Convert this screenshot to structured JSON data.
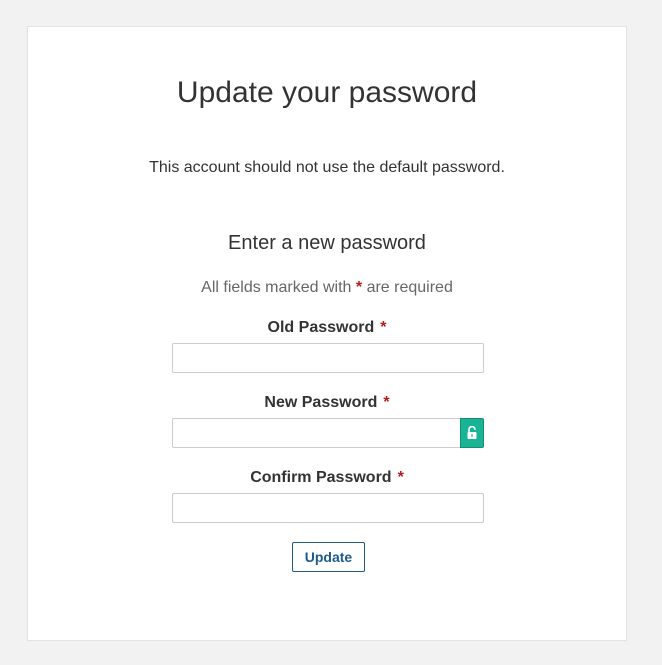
{
  "page": {
    "title": "Update your password",
    "subtitle": "This account should not use the default password."
  },
  "form": {
    "section_title": "Enter a new password",
    "required_note_before": "All fields marked with",
    "required_marker": "*",
    "required_note_after": "are required",
    "fields": [
      {
        "label": "Old Password",
        "value": "",
        "required": true
      },
      {
        "label": "New Password",
        "value": "",
        "required": true,
        "addon_icon": "unlock-icon"
      },
      {
        "label": "Confirm Password",
        "value": "",
        "required": true
      }
    ],
    "submit_label": "Update"
  },
  "colors": {
    "background": "#f2f2f2",
    "card": "#ffffff",
    "required_marker": "#b31b1b",
    "lock_button": "#1ab394",
    "button_text": "#1e5a8c"
  }
}
